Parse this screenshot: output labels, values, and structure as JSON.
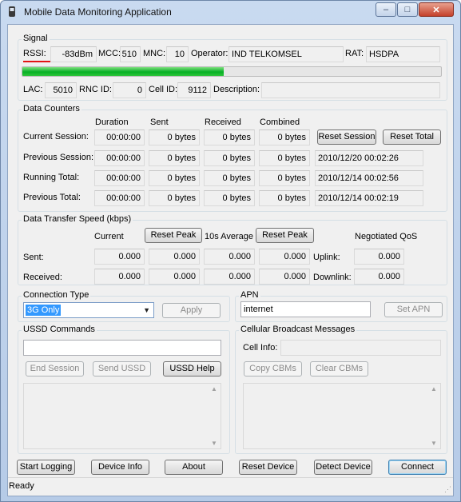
{
  "window": {
    "title": "Mobile Data Monitoring Application",
    "min_glyph": "–",
    "max_glyph": "□",
    "close_glyph": "✕"
  },
  "signal": {
    "title": "Signal",
    "rssi_label": "RSSI:",
    "rssi": "-83dBm",
    "mcc_label": "MCC:",
    "mcc": "510",
    "mnc_label": "MNC:",
    "mnc": "10",
    "operator_label": "Operator:",
    "operator": "IND TELKOMSEL",
    "rat_label": "RAT:",
    "rat": "HSDPA",
    "strength_fraction": 0.48,
    "lac_label": "LAC:",
    "lac": "5010",
    "rnc_label": "RNC ID:",
    "rnc": "0",
    "cell_label": "Cell ID:",
    "cell": "9112",
    "desc_label": "Description:",
    "desc": ""
  },
  "counters": {
    "title": "Data Counters",
    "headers": [
      "Duration",
      "Sent",
      "Received",
      "Combined"
    ],
    "rows": [
      {
        "label": "Current Session:",
        "duration": "00:00:00",
        "sent": "0 bytes",
        "received": "0 bytes",
        "combined": "0 bytes"
      },
      {
        "label": "Previous Session:",
        "duration": "00:00:00",
        "sent": "0 bytes",
        "received": "0 bytes",
        "combined": "0 bytes",
        "extra": "2010/12/20 00:02:26"
      },
      {
        "label": "Running Total:",
        "duration": "00:00:00",
        "sent": "0 bytes",
        "received": "0 bytes",
        "combined": "0 bytes",
        "extra": "2010/12/14 00:02:56"
      },
      {
        "label": "Previous Total:",
        "duration": "00:00:00",
        "sent": "0 bytes",
        "received": "0 bytes",
        "combined": "0 bytes",
        "extra": "2010/12/14 00:02:19"
      }
    ],
    "reset_session": "Reset Session",
    "reset_total": "Reset Total"
  },
  "speed": {
    "title": "Data Transfer Speed (kbps)",
    "current_label": "Current",
    "reset_peak_1": "Reset Peak",
    "avg_label": "10s Average",
    "reset_peak_2": "Reset Peak",
    "qos_label": "Negotiated QoS",
    "sent_label": "Sent:",
    "received_label": "Received:",
    "sent": [
      "0.000",
      "0.000",
      "0.000",
      "0.000"
    ],
    "received": [
      "0.000",
      "0.000",
      "0.000",
      "0.000"
    ],
    "uplink_label": "Uplink:",
    "uplink": "0.000",
    "downlink_label": "Downlink:",
    "downlink": "0.000"
  },
  "connection": {
    "title": "Connection Type",
    "selected": "3G Only",
    "apply": "Apply"
  },
  "apn": {
    "title": "APN",
    "value": "internet",
    "set": "Set APN"
  },
  "ussd": {
    "title": "USSD Commands",
    "input": "",
    "end": "End Session",
    "send": "Send USSD",
    "help": "USSD Help"
  },
  "cbm": {
    "title": "Cellular Broadcast Messages",
    "cell_info_label": "Cell Info:",
    "copy": "Copy CBMs",
    "clear": "Clear CBMs"
  },
  "bottom": {
    "start_logging": "Start Logging",
    "device_info": "Device Info",
    "about": "About",
    "reset_device": "Reset Device",
    "detect_device": "Detect Device",
    "connect": "Connect"
  },
  "status": {
    "text": "Ready"
  },
  "colors": {
    "accent_red": "#e21414",
    "progress_green": "#06b025",
    "selection_blue": "#3399ff"
  }
}
